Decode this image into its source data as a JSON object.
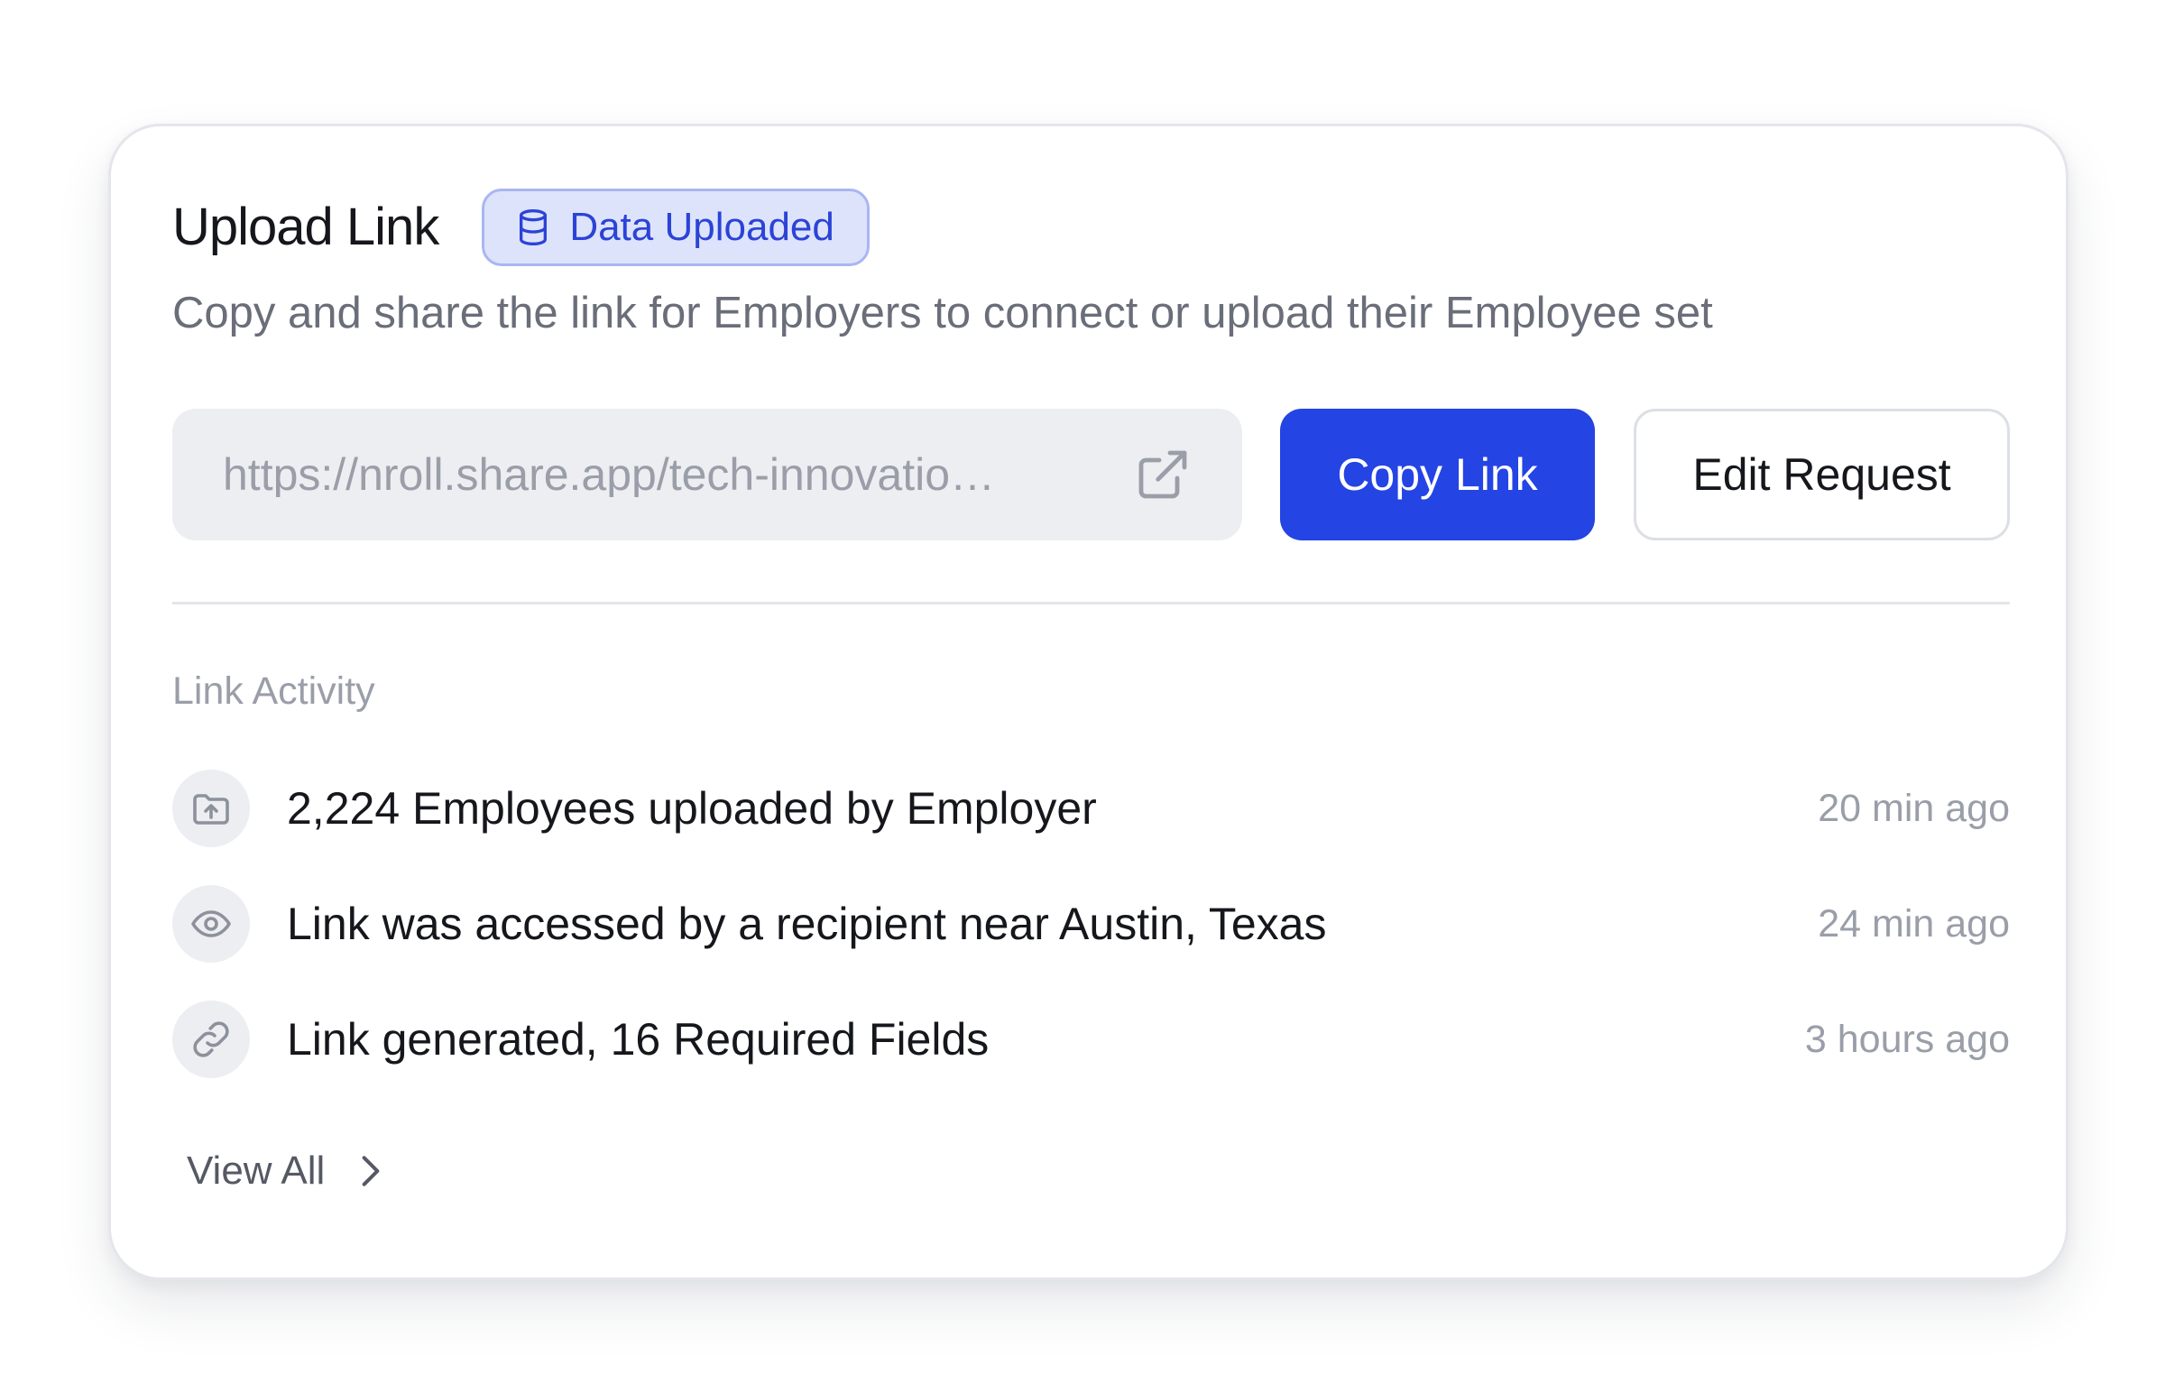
{
  "card": {
    "title": "Upload Link",
    "badge": {
      "label": "Data Uploaded",
      "icon": "database-icon"
    },
    "subtitle": "Copy and share the link for Employers to connect or upload their Employee set"
  },
  "link_field": {
    "value": "https://nroll.share.app/tech-innovatio…",
    "icon": "external-link-icon"
  },
  "buttons": {
    "copy_label": "Copy Link",
    "edit_label": "Edit Request"
  },
  "activity": {
    "section_label": "Link Activity",
    "items": [
      {
        "icon": "folder-upload-icon",
        "text": "2,224 Employees uploaded by Employer",
        "time": "20 min ago"
      },
      {
        "icon": "eye-icon",
        "text": "Link was accessed by a recipient near Austin, Texas",
        "time": "24 min ago"
      },
      {
        "icon": "link-icon",
        "text": "Link generated, 16 Required Fields",
        "time": "3 hours ago"
      }
    ],
    "view_all_label": "View All"
  },
  "colors": {
    "accent": "#2444e4",
    "badge_bg": "#dde3fb",
    "badge_text": "#2b43d6",
    "muted_text": "#9a9ea8",
    "field_bg": "#eceef2"
  }
}
